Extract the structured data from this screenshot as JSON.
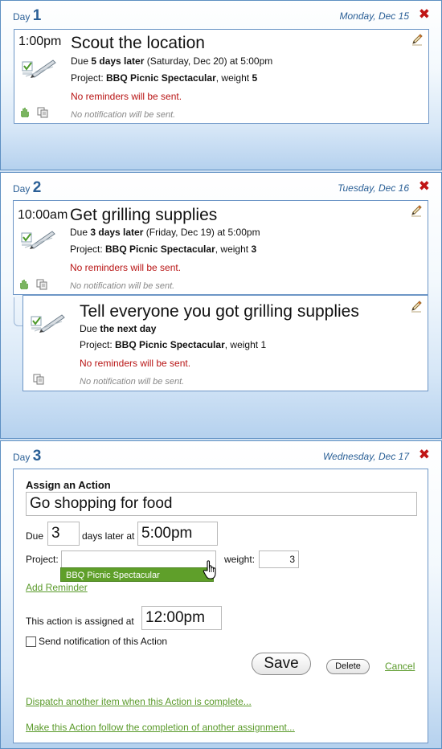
{
  "days": [
    {
      "label": "Day",
      "number": "1",
      "date": "Monday, Dec 15",
      "close": "✖",
      "actions": [
        {
          "time": "1:00pm",
          "title": "Scout the location",
          "due_prefix": "Due ",
          "due_bold": "5 days later",
          "due_rest": " (Saturday, Dec 20) at 5:00pm",
          "project_prefix": "Project: ",
          "project_name": "BBQ Picnic Spectacular",
          "weight_prefix": ", weight ",
          "weight": "5",
          "reminders": "No reminders will be sent.",
          "notification": "No notification will be sent."
        }
      ]
    },
    {
      "label": "Day",
      "number": "2",
      "date": "Tuesday, Dec 16",
      "close": "✖",
      "actions": [
        {
          "time": "10:00am",
          "title": "Get grilling supplies",
          "due_prefix": "Due ",
          "due_bold": "3 days later",
          "due_rest": " (Friday, Dec 19) at 5:00pm",
          "project_prefix": "Project: ",
          "project_name": "BBQ Picnic Spectacular",
          "weight_prefix": ", weight ",
          "weight": "3",
          "reminders": "No reminders will be sent.",
          "notification": "No notification will be sent."
        },
        {
          "title": "Tell everyone you got grilling supplies",
          "due_prefix": "Due ",
          "due_bold": "the next day",
          "project_prefix": "Project: ",
          "project_name": "BBQ Picnic Spectacular",
          "weight_prefix": ", weight ",
          "weight": "1",
          "reminders": "No reminders will be sent.",
          "notification": "No notification will be sent."
        }
      ]
    },
    {
      "label": "Day",
      "number": "3",
      "date": "Wednesday, Dec 17",
      "close": "✖"
    }
  ],
  "form": {
    "heading": "Assign an Action",
    "action_name": "Go shopping for food",
    "due_label": "Due",
    "due_days": "3",
    "days_later_label": "days later at",
    "due_time": "5:00pm",
    "project_label": "Project:",
    "project_value": "",
    "weight_label": "weight:",
    "weight_value": "3",
    "dropdown_option": "BBQ Picnic Spectacular",
    "add_reminder": "Add Reminder",
    "assigned_label": "This action is assigned at",
    "assigned_time": "12:00pm",
    "notify_label": "Send notification of this Action",
    "save": "Save",
    "delete": "Delete",
    "cancel": "Cancel",
    "dispatch_link": "Dispatch another item when this Action is complete...",
    "follow_link": "Make this Action follow the completion of another assignment..."
  },
  "icons": {
    "close": "close-icon",
    "edit": "pencil-icon",
    "action": "checked-action-icon",
    "hand": "hand-icon",
    "copy": "copy-icon",
    "cursor": "hand-cursor-icon"
  },
  "colors": {
    "day_blue": "#2a5f96",
    "close_red": "#c01515",
    "reminder_red": "#b81414",
    "link_green": "#5a9a2a",
    "dropdown_green": "#5f9f2a"
  }
}
